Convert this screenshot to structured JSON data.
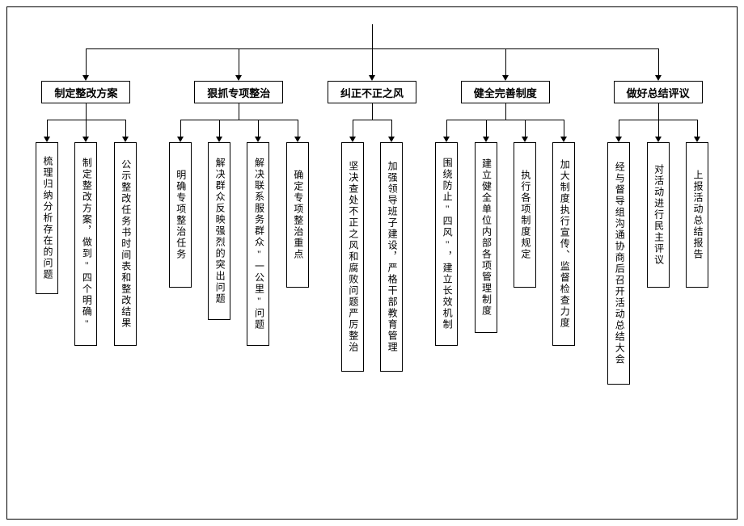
{
  "chart_data": {
    "type": "tree",
    "categories": [
      {
        "label": "制定整改方案",
        "leaves": [
          "梳理归纳分析存在的问题",
          "制定整改方案，做到\"四个明确\"",
          "公示整改任务书时间表和整改结果"
        ]
      },
      {
        "label": "狠抓专项整治",
        "leaves": [
          "明确专项整治任务",
          "解决群众反映强烈的突出问题",
          "解决联系服务群众\"一公里\"问题",
          "确定专项整治重点"
        ]
      },
      {
        "label": "纠正不正之风",
        "leaves": [
          "坚决查处不正之风和腐败问题严厉整治",
          "加强领导班子建设，严格干部教育管理"
        ]
      },
      {
        "label": "健全完善制度",
        "leaves": [
          "围绕防止\"四风\"，建立长效机制",
          "建立健全单位内部各项管理制度",
          "执行各项制度规定",
          "加大制度执行宣传、监督检查力度"
        ]
      },
      {
        "label": "做好总结评议",
        "leaves": [
          "经与督导组沟通协商后召开活动总结大会",
          "对活动进行民主评议",
          "上报活动总结报告"
        ]
      }
    ]
  }
}
